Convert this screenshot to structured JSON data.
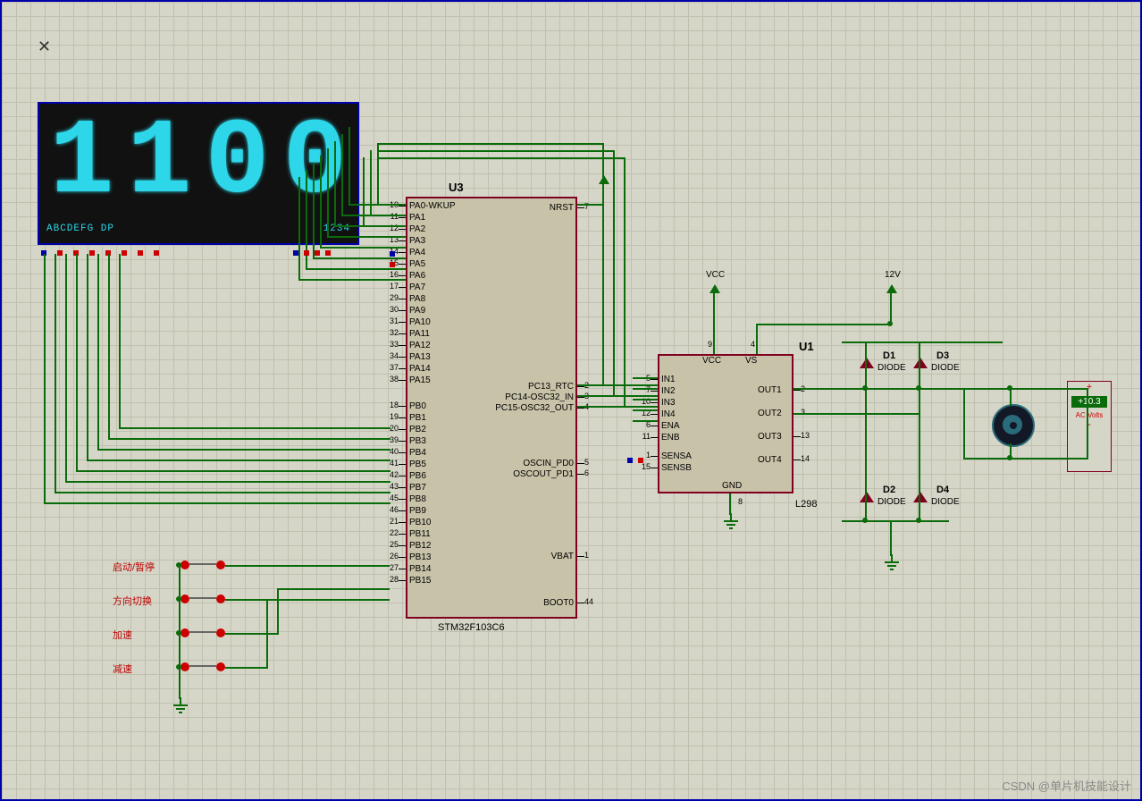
{
  "display": {
    "value": "1100",
    "footer_left": "ABCDEFG DP",
    "footer_right": "1234"
  },
  "u3": {
    "ref": "U3",
    "part": "STM32F103C6",
    "left_pins": [
      {
        "num": "10",
        "name": "PA0-WKUP"
      },
      {
        "num": "11",
        "name": "PA1"
      },
      {
        "num": "12",
        "name": "PA2"
      },
      {
        "num": "13",
        "name": "PA3"
      },
      {
        "num": "14",
        "name": "PA4"
      },
      {
        "num": "15",
        "name": "PA5"
      },
      {
        "num": "16",
        "name": "PA6"
      },
      {
        "num": "17",
        "name": "PA7"
      },
      {
        "num": "29",
        "name": "PA8"
      },
      {
        "num": "30",
        "name": "PA9"
      },
      {
        "num": "31",
        "name": "PA10"
      },
      {
        "num": "32",
        "name": "PA11"
      },
      {
        "num": "33",
        "name": "PA12"
      },
      {
        "num": "34",
        "name": "PA13"
      },
      {
        "num": "37",
        "name": "PA14"
      },
      {
        "num": "38",
        "name": "PA15"
      },
      {
        "num": "18",
        "name": "PB0"
      },
      {
        "num": "19",
        "name": "PB1"
      },
      {
        "num": "20",
        "name": "PB2"
      },
      {
        "num": "39",
        "name": "PB3"
      },
      {
        "num": "40",
        "name": "PB4"
      },
      {
        "num": "41",
        "name": "PB5"
      },
      {
        "num": "42",
        "name": "PB6"
      },
      {
        "num": "43",
        "name": "PB7"
      },
      {
        "num": "45",
        "name": "PB8"
      },
      {
        "num": "46",
        "name": "PB9"
      },
      {
        "num": "21",
        "name": "PB10"
      },
      {
        "num": "22",
        "name": "PB11"
      },
      {
        "num": "25",
        "name": "PB12"
      },
      {
        "num": "26",
        "name": "PB13"
      },
      {
        "num": "27",
        "name": "PB14"
      },
      {
        "num": "28",
        "name": "PB15"
      }
    ],
    "right_pins": [
      {
        "num": "7",
        "name": "NRST"
      },
      {
        "num": "2",
        "name": "PC13_RTC"
      },
      {
        "num": "3",
        "name": "PC14-OSC32_IN"
      },
      {
        "num": "4",
        "name": "PC15-OSC32_OUT"
      },
      {
        "num": "5",
        "name": "OSCIN_PD0"
      },
      {
        "num": "6",
        "name": "OSCOUT_PD1"
      },
      {
        "num": "1",
        "name": "VBAT"
      },
      {
        "num": "44",
        "name": "BOOT0"
      }
    ]
  },
  "u1": {
    "ref": "U1",
    "part": "L298",
    "left_pins": [
      {
        "num": "5",
        "name": "IN1"
      },
      {
        "num": "7",
        "name": "IN2"
      },
      {
        "num": "10",
        "name": "IN3"
      },
      {
        "num": "12",
        "name": "IN4"
      },
      {
        "num": "6",
        "name": "ENA"
      },
      {
        "num": "11",
        "name": "ENB"
      },
      {
        "num": "1",
        "name": "SENSA"
      },
      {
        "num": "15",
        "name": "SENSB"
      }
    ],
    "top_pins": [
      {
        "num": "9",
        "name": "VCC"
      },
      {
        "num": "4",
        "name": "VS"
      }
    ],
    "right_pins": [
      {
        "num": "2",
        "name": "OUT1"
      },
      {
        "num": "3",
        "name": "OUT2"
      },
      {
        "num": "13",
        "name": "OUT3"
      },
      {
        "num": "14",
        "name": "OUT4"
      }
    ],
    "bottom": {
      "num": "8",
      "name": "GND"
    }
  },
  "power": {
    "vcc": "VCC",
    "v12": "12V"
  },
  "diodes": {
    "d1": {
      "ref": "D1",
      "part": "DIODE"
    },
    "d2": {
      "ref": "D2",
      "part": "DIODE"
    },
    "d3": {
      "ref": "D3",
      "part": "DIODE"
    },
    "d4": {
      "ref": "D4",
      "part": "DIODE"
    }
  },
  "meter": {
    "plus": "+",
    "minus": "-",
    "value": "+10.3",
    "label": "AC Volts"
  },
  "buttons": {
    "b1": "启动/暂停",
    "b2": "方向切换",
    "b3": "加速",
    "b4": "减速"
  },
  "watermark": "CSDN @单片机技能设计"
}
